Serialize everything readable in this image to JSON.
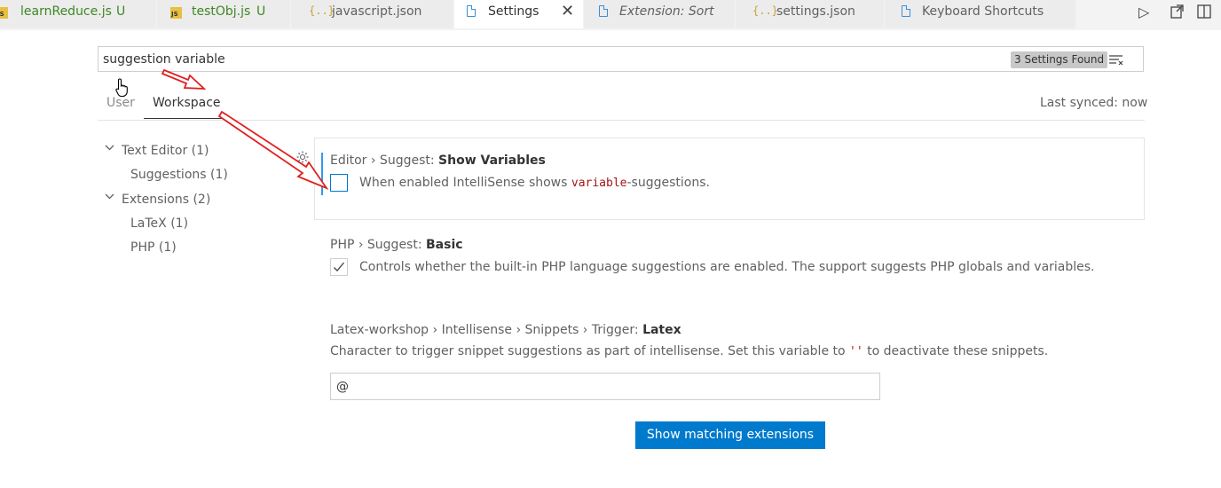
{
  "tabs": [
    {
      "label": "learnReduce.js",
      "badge": "U",
      "icon": "js-file-icon",
      "state": "modified"
    },
    {
      "label": "testObj.js",
      "badge": "U",
      "icon": "js-file-icon",
      "state": "modified"
    },
    {
      "label": "javascript.json",
      "icon": "json-file-icon"
    },
    {
      "label": "Settings",
      "icon": "file-icon",
      "active": true,
      "close": "✕"
    },
    {
      "label": "Extension: Sort",
      "icon": "file-icon",
      "italic": true
    },
    {
      "label": "settings.json",
      "icon": "json-file-icon"
    },
    {
      "label": "Keyboard Shortcuts",
      "icon": "file-icon"
    }
  ],
  "editor_actions": [
    "run-icon",
    "open-preview-icon",
    "split-editor-icon"
  ],
  "search": {
    "value": "suggestion variable",
    "results_badge": "3 Settings Found",
    "clear_icon": "clear-filter-icon"
  },
  "scopes": {
    "user": "User",
    "workspace": "Workspace",
    "active": "workspace"
  },
  "sync_status": "Last synced: now",
  "toc": {
    "text_editor": {
      "label": "Text Editor (1)",
      "children": [
        "Suggestions (1)"
      ]
    },
    "extensions": {
      "label": "Extensions (2)",
      "children": [
        "LaTeX (1)",
        "PHP (1)"
      ]
    }
  },
  "settings": [
    {
      "category": "Editor › Suggest: ",
      "name": "Show Variables",
      "desc_before": "When enabled IntelliSense shows ",
      "desc_code": "variable",
      "desc_after": "-suggestions.",
      "checked": false
    },
    {
      "category": "PHP › Suggest: ",
      "name": "Basic",
      "desc": "Controls whether the built-in PHP language suggestions are enabled. The support suggests PHP globals and variables.",
      "checked": true
    },
    {
      "category": "Latex-workshop › Intellisense › Snippets › Trigger: ",
      "name": "Latex",
      "desc_before": "Character to trigger snippet suggestions as part of intellisense. Set this variable to ",
      "desc_code": "''",
      "desc_after": " to deactivate these snippets.",
      "value": "@"
    }
  ],
  "show_extensions_button": "Show matching extensions",
  "colors": {
    "accent": "#007acc",
    "annotation": "#e02020",
    "modified": "#3e8724"
  }
}
